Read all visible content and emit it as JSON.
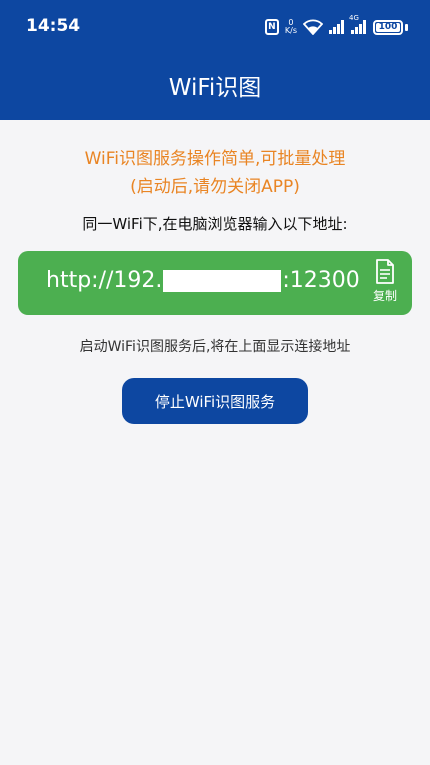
{
  "status_bar": {
    "time": "14:54",
    "nfc": "N",
    "speed_value": "0",
    "speed_unit": "K/s",
    "network": "4G",
    "battery": "100",
    "icons": [
      "nfc-icon",
      "wifi-icon",
      "signal-icon",
      "signal-4g-icon",
      "battery-icon"
    ]
  },
  "header": {
    "title": "WiFi识图"
  },
  "promo": {
    "line1": "WiFi识图服务操作简单,可批量处理",
    "line2": "(启动后,请勿关闭APP)",
    "color": "#e98524"
  },
  "instruction": "同一WiFi下,在电脑浏览器输入以下地址:",
  "url": {
    "prefix": "http://192.",
    "suffix": ":12300",
    "copy_label": "复制",
    "card_color": "#4caf50"
  },
  "hint": "启动WiFi识图服务后,将在上面显示连接地址",
  "stop_button": {
    "label": "停止WiFi识图服务",
    "color": "#0d47a1"
  }
}
